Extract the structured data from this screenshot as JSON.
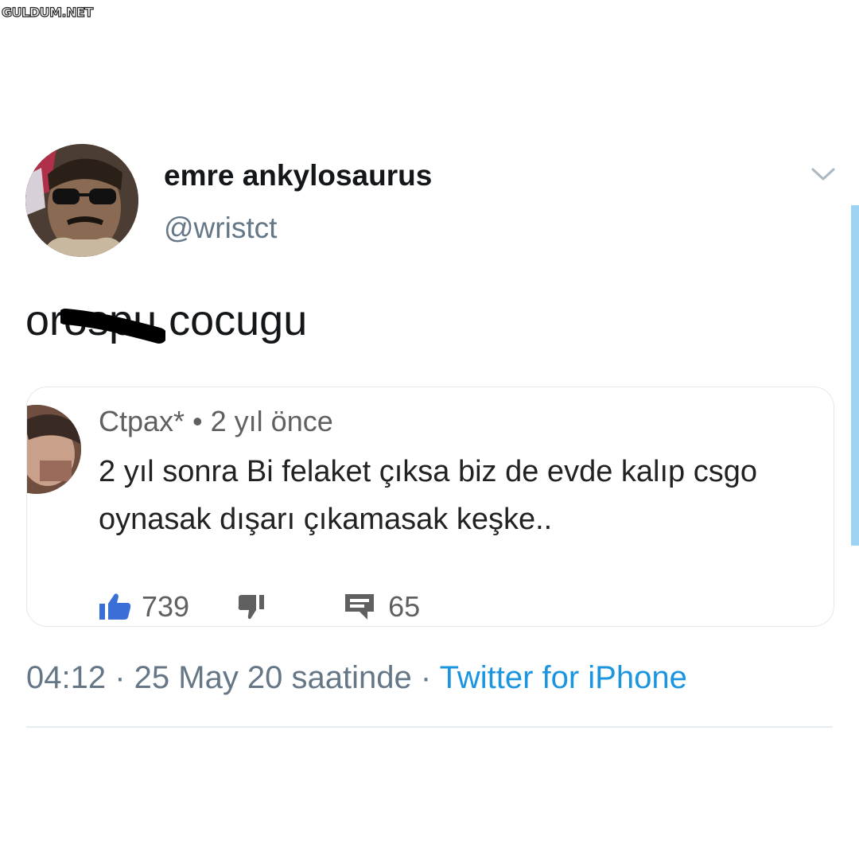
{
  "watermark": {
    "text": "GULDUM.NET"
  },
  "tweet": {
    "display_name": "emre ankylosaurus",
    "handle": "@wristct",
    "text": "orospu cocugu",
    "icons": {
      "menu": "chevron-down-icon"
    }
  },
  "quoted_comment": {
    "author_meta": "Ctpax* • 2 yıl önce",
    "text": "2 yıl sonra Bi felaket çıksa biz de evde kalıp csgo oynasak dışarı çıkamasak keşke..",
    "likes": "739",
    "replies": "65",
    "icons": {
      "like": "thumbs-up-icon",
      "dislike": "thumbs-down-icon",
      "reply": "comment-icon"
    }
  },
  "footer": {
    "timestamp": "04:12 · 25 May 20 saatinde",
    "separator": " · ",
    "source": "Twitter for iPhone"
  },
  "colors": {
    "name": "#14171a",
    "secondary": "#657786",
    "link": "#1b95e0",
    "like_blue": "#3a6fd8",
    "scrollbar": "#9fd3f3"
  }
}
